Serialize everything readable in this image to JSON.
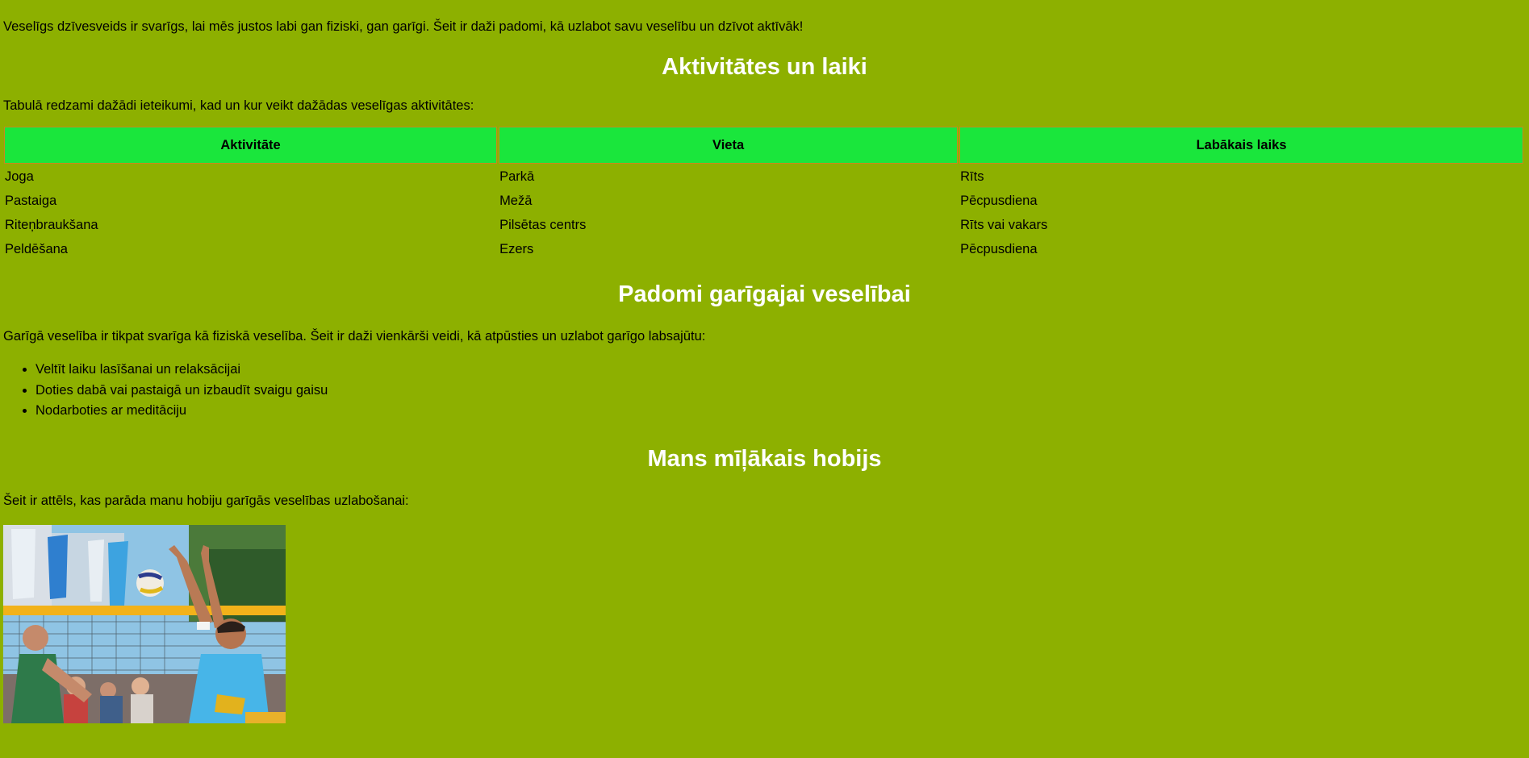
{
  "intro_text": "Veselīgs dzīvesveids ir svarīgs, lai mēs justos labi gan fiziski, gan garīgi. Šeit ir daži padomi, kā uzlabot savu veselību un dzīvot aktīvāk!",
  "activities_section": {
    "heading": "Aktivitātes un laiki",
    "intro": "Tabulā redzami dažādi ieteikumi, kad un kur veikt dažādas veselīgas aktivitātes:",
    "columns": [
      "Aktivitāte",
      "Vieta",
      "Labākais laiks"
    ],
    "rows": [
      [
        "Joga",
        "Parkā",
        "Rīts"
      ],
      [
        "Pastaiga",
        "Mežā",
        "Pēcpusdiena"
      ],
      [
        "Riteņbraukšana",
        "Pilsētas centrs",
        "Rīts vai vakars"
      ],
      [
        "Peldēšana",
        "Ezers",
        "Pēcpusdiena"
      ]
    ]
  },
  "mental_section": {
    "heading": "Padomi garīgajai veselībai",
    "intro": "Garīgā veselība ir tikpat svarīga kā fiziskā veselība. Šeit ir daži vienkārši veidi, kā atpūsties un uzlabot garīgo labsajūtu:",
    "tips": [
      "Veltīt laiku lasīšanai un relaksācijai",
      "Doties dabā vai pastaigā un izbaudīt svaigu gaisu",
      "Nodarboties ar meditāciju"
    ]
  },
  "hobby_section": {
    "heading": "Mans mīļākais hobijs",
    "intro": "Šeit ir attēls, kas parāda manu hobiju garīgās veselības uzlabošanai:"
  },
  "colors": {
    "page_background": "#8db000",
    "heading_color": "#ffffff",
    "table_header_background": "#1ae63c",
    "table_header_border": "#c9871e"
  }
}
